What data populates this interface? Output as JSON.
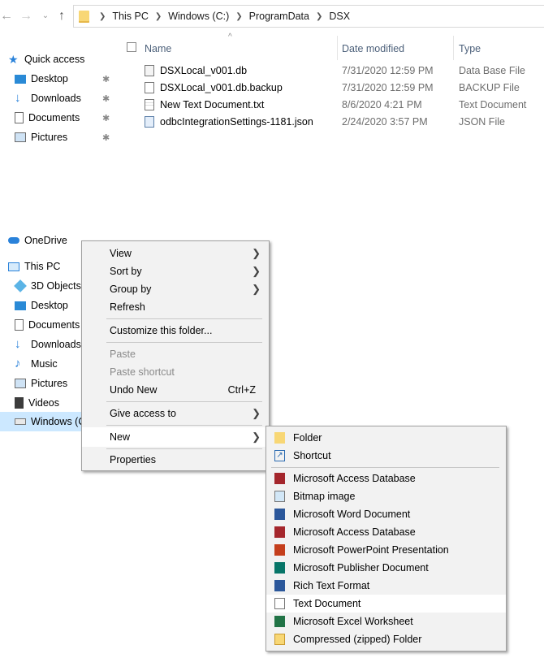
{
  "breadcrumb": [
    "This PC",
    "Windows (C:)",
    "ProgramData",
    "DSX"
  ],
  "columns": {
    "name": "Name",
    "date": "Date modified",
    "type": "Type"
  },
  "nav": {
    "quick_access": "Quick access",
    "quick_items": [
      "Desktop",
      "Downloads",
      "Documents",
      "Pictures"
    ],
    "onedrive": "OneDrive",
    "this_pc": "This PC",
    "pc_items": [
      "3D Objects",
      "Desktop",
      "Documents",
      "Downloads",
      "Music",
      "Pictures",
      "Videos",
      "Windows (C"
    ]
  },
  "files": [
    {
      "name": "DSXLocal_v001.db",
      "date": "7/31/2020 12:59 PM",
      "type": "Data Base File"
    },
    {
      "name": "DSXLocal_v001.db.backup",
      "date": "7/31/2020 12:59 PM",
      "type": "BACKUP File"
    },
    {
      "name": "New Text Document.txt",
      "date": "8/6/2020 4:21 PM",
      "type": "Text Document"
    },
    {
      "name": "odbcIntegrationSettings-1181.json",
      "date": "2/24/2020 3:57 PM",
      "type": "JSON File"
    }
  ],
  "context_menu": {
    "view": "View",
    "sort_by": "Sort by",
    "group_by": "Group by",
    "refresh": "Refresh",
    "customize": "Customize this folder...",
    "paste": "Paste",
    "paste_shortcut": "Paste shortcut",
    "undo_new": "Undo New",
    "undo_shortcut": "Ctrl+Z",
    "give_access": "Give access to",
    "new": "New",
    "properties": "Properties"
  },
  "new_submenu": [
    "Folder",
    "Shortcut",
    "Microsoft Access Database",
    "Bitmap image",
    "Microsoft Word Document",
    "Microsoft Access Database",
    "Microsoft PowerPoint Presentation",
    "Microsoft Publisher Document",
    "Rich Text Format",
    "Text Document",
    "Microsoft Excel Worksheet",
    "Compressed (zipped) Folder"
  ],
  "colors": {
    "accent": "#0078d7",
    "folder": "#f8d775",
    "header_text": "#4c607a"
  }
}
